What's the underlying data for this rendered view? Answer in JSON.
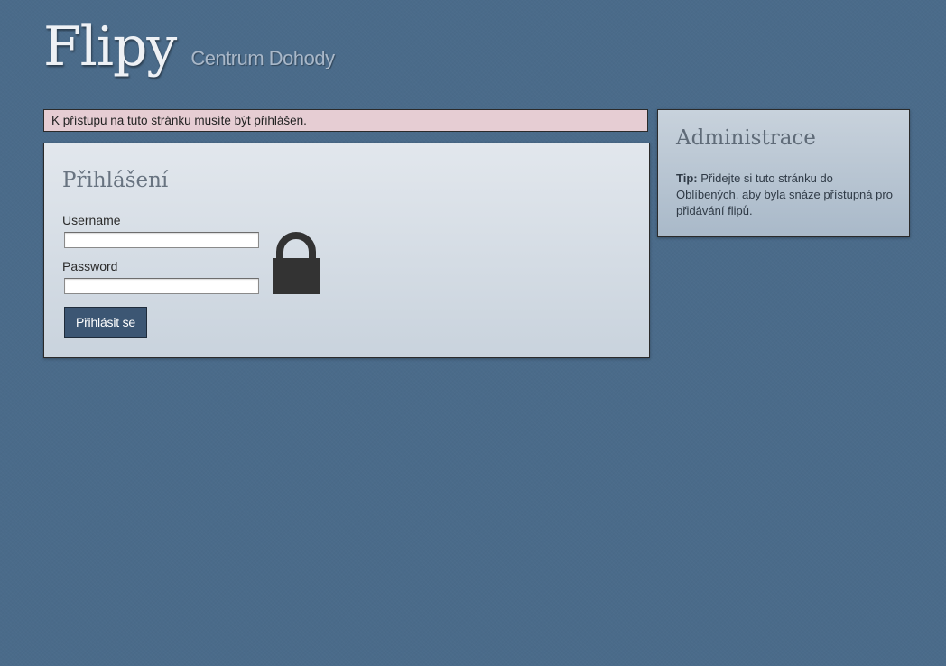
{
  "header": {
    "title": "Flipy",
    "subtitle": "Centrum Dohody"
  },
  "flash": {
    "message": "K přístupu na tuto stránku musíte být přihlášen."
  },
  "login": {
    "heading": "Přihlášení",
    "username_label": "Username",
    "username_value": "",
    "password_label": "Password",
    "password_value": "",
    "submit_label": "Přihlásit se",
    "icon": "lock-icon"
  },
  "admin": {
    "heading": "Administrace",
    "tip_label": "Tip:",
    "tip_text": "Přidejte si tuto stránku do Oblíbených, aby byla snáze přístupná pro přidávání flipů."
  },
  "colors": {
    "background": "#4a6b8a",
    "flash_background": "#e6cdd3",
    "button_background": "#3c5673",
    "lock_icon": "#333333"
  }
}
